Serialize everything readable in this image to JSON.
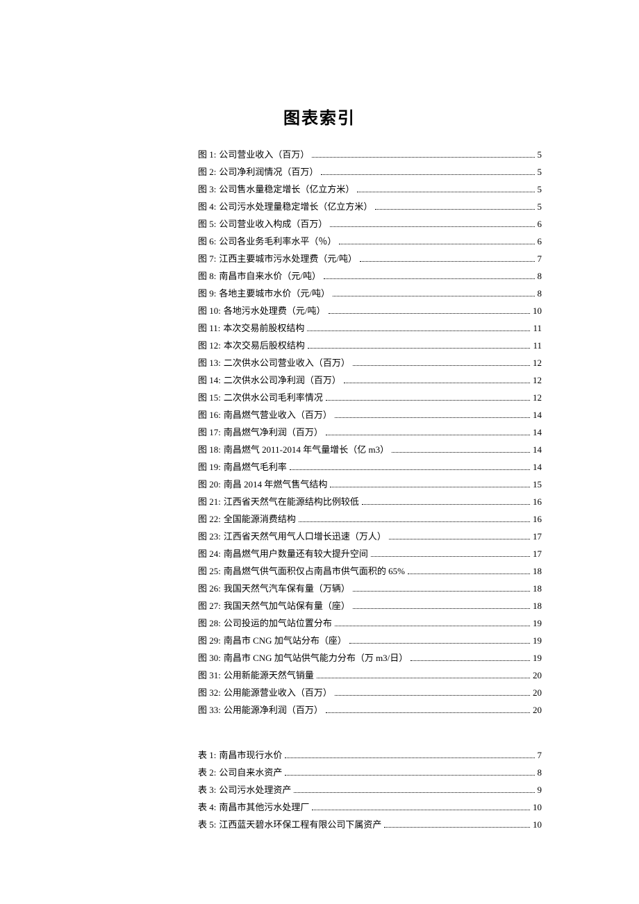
{
  "title": "图表索引",
  "figures": [
    {
      "prefix": "图 1:",
      "text": "公司营业收入（百万）",
      "page": "5"
    },
    {
      "prefix": "图 2:",
      "text": "公司净利润情况（百万）",
      "page": "5"
    },
    {
      "prefix": "图 3:",
      "text": "公司售水量稳定增长（亿立方米）",
      "page": "5"
    },
    {
      "prefix": "图 4:",
      "text": "公司污水处理量稳定增长（亿立方米）",
      "page": "5"
    },
    {
      "prefix": "图 5:",
      "text": "公司营业收入构成（百万）",
      "page": "6"
    },
    {
      "prefix": "图 6:",
      "text": "公司各业务毛利率水平（％）",
      "page": "6"
    },
    {
      "prefix": "图 7:",
      "text": "江西主要城市污水处理费（元/吨）",
      "page": "7"
    },
    {
      "prefix": "图 8:",
      "text": "南昌市自来水价（元/吨）",
      "page": "8"
    },
    {
      "prefix": "图 9:",
      "text": "各地主要城市水价（元/吨）",
      "page": "8"
    },
    {
      "prefix": "图 10:",
      "text": "各地污水处理费（元/吨）",
      "page": "10"
    },
    {
      "prefix": "图 11:",
      "text": "本次交易前股权结构",
      "page": "11"
    },
    {
      "prefix": "图 12:",
      "text": "本次交易后股权结构",
      "page": "11"
    },
    {
      "prefix": "图 13:",
      "text": "二次供水公司营业收入（百万）",
      "page": "12"
    },
    {
      "prefix": "图 14:",
      "text": "二次供水公司净利润（百万）",
      "page": "12"
    },
    {
      "prefix": "图 15:",
      "text": "二次供水公司毛利率情况",
      "page": "12"
    },
    {
      "prefix": "图 16:",
      "text": "南昌燃气营业收入（百万）",
      "page": "14"
    },
    {
      "prefix": "图 17:",
      "text": "南昌燃气净利润（百万）",
      "page": "14"
    },
    {
      "prefix": "图 18:",
      "text": "南昌燃气 2011-2014 年气量增长（亿 m3）",
      "page": "14"
    },
    {
      "prefix": "图 19:",
      "text": "南昌燃气毛利率",
      "page": "14"
    },
    {
      "prefix": "图 20:",
      "text": "南昌 2014 年燃气售气结构",
      "page": "15"
    },
    {
      "prefix": "图 21:",
      "text": "江西省天然气在能源结构比例较低",
      "page": "16"
    },
    {
      "prefix": "图 22:",
      "text": "全国能源消费结构",
      "page": "16"
    },
    {
      "prefix": "图 23:",
      "text": "江西省天然气用气人口增长迅速（万人）",
      "page": "17"
    },
    {
      "prefix": "图 24:",
      "text": "南昌燃气用户数量还有较大提升空间",
      "page": "17"
    },
    {
      "prefix": "图 25:",
      "text": "南昌燃气供气面积仅占南昌市供气面积的 65%",
      "page": "18"
    },
    {
      "prefix": "图 26:",
      "text": "我国天然气汽车保有量（万辆）",
      "page": "18"
    },
    {
      "prefix": "图 27:",
      "text": "我国天然气加气站保有量（座）",
      "page": "18"
    },
    {
      "prefix": "图 28:",
      "text": "公司投运的加气站位置分布",
      "page": "19"
    },
    {
      "prefix": "图 29:",
      "text": "南昌市 CNG 加气站分布（座）",
      "page": "19"
    },
    {
      "prefix": "图 30:",
      "text": "南昌市 CNG 加气站供气能力分布（万 m3/日）",
      "page": "19"
    },
    {
      "prefix": "图 31:",
      "text": "公用新能源天然气销量",
      "page": "20"
    },
    {
      "prefix": "图 32:",
      "text": "公用能源营业收入（百万）",
      "page": "20"
    },
    {
      "prefix": "图 33:",
      "text": "公用能源净利润（百万）",
      "page": "20"
    }
  ],
  "tables": [
    {
      "prefix": "表 1:",
      "text": "南昌市现行水价",
      "page": "7"
    },
    {
      "prefix": "表 2:",
      "text": "公司自来水资产",
      "page": "8"
    },
    {
      "prefix": "表 3:",
      "text": "公司污水处理资产",
      "page": "9"
    },
    {
      "prefix": "表 4:",
      "text": "南昌市其他污水处理厂",
      "page": "10"
    },
    {
      "prefix": "表 5:",
      "text": "江西蓝天碧水环保工程有限公司下属资产",
      "page": "10"
    }
  ]
}
